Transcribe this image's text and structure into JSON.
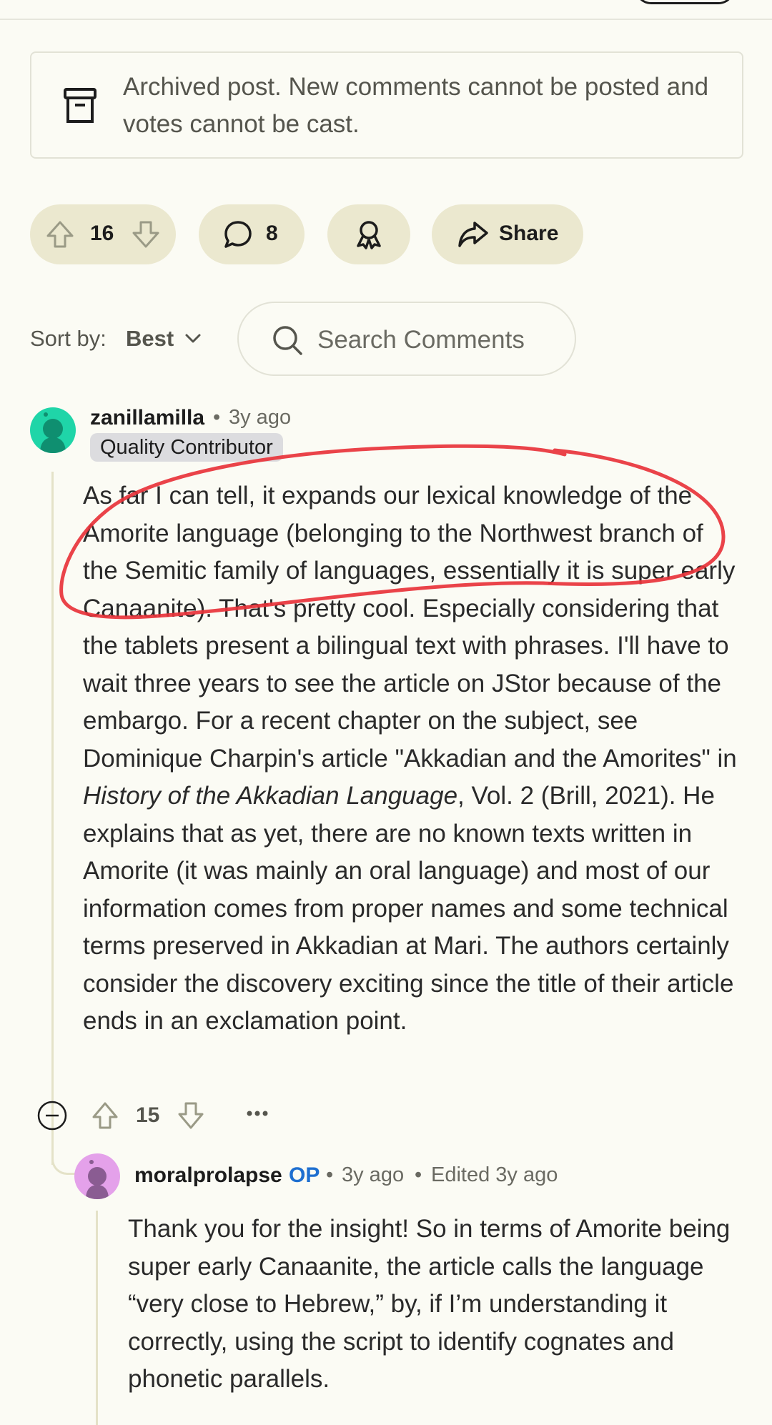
{
  "archived": {
    "message": "Archived post. New comments cannot be posted and votes cannot be cast."
  },
  "post_actions": {
    "vote_count": "16",
    "comment_count": "8",
    "share_label": "Share"
  },
  "sort": {
    "label": "Sort by:",
    "value": "Best"
  },
  "search": {
    "placeholder": "Search Comments"
  },
  "comments": [
    {
      "author": "zanillamilla",
      "age": "3y ago",
      "flair": "Quality Contributor",
      "body_part1": "As far I can tell, it expands our lexical knowledge of the Amorite language (belonging to the Northwest branch of the Semitic family of languages, essentially it is super early Canaanite). That's pretty cool. Especially considering that the tablets present a bilingual text with phrases. I'll have to wait three years to see the article on JStor because of the embargo. For a recent chapter on the subject, see Dominique Charpin's article \"Akkadian and the Amorites\" in ",
      "body_italic": "History of the Akkadian Language",
      "body_part2": ", Vol. 2 (Brill, 2021). He explains that as yet, there are no known texts written in Amorite (it was mainly an oral language) and most of our information comes from proper names and some technical terms preserved in Akkadian at Mari. The authors certainly consider the discovery exciting since the title of their article ends in an exclamation point.",
      "score": "15"
    },
    {
      "author": "moralprolapse",
      "op_tag": "OP",
      "age": "3y ago",
      "edited": "Edited 3y ago",
      "body": "Thank you for the insight! So in terms of Amorite being super early Canaanite, the article calls the language “very close to Hebrew,” by, if I’m understanding it correctly, using the script to identify cognates and phonetic parallels."
    }
  ],
  "colors": {
    "background": "#fbfbf4",
    "pill": "#ebe8cf",
    "annotation_red": "#e8333a",
    "op_blue": "#1e6fd0"
  }
}
